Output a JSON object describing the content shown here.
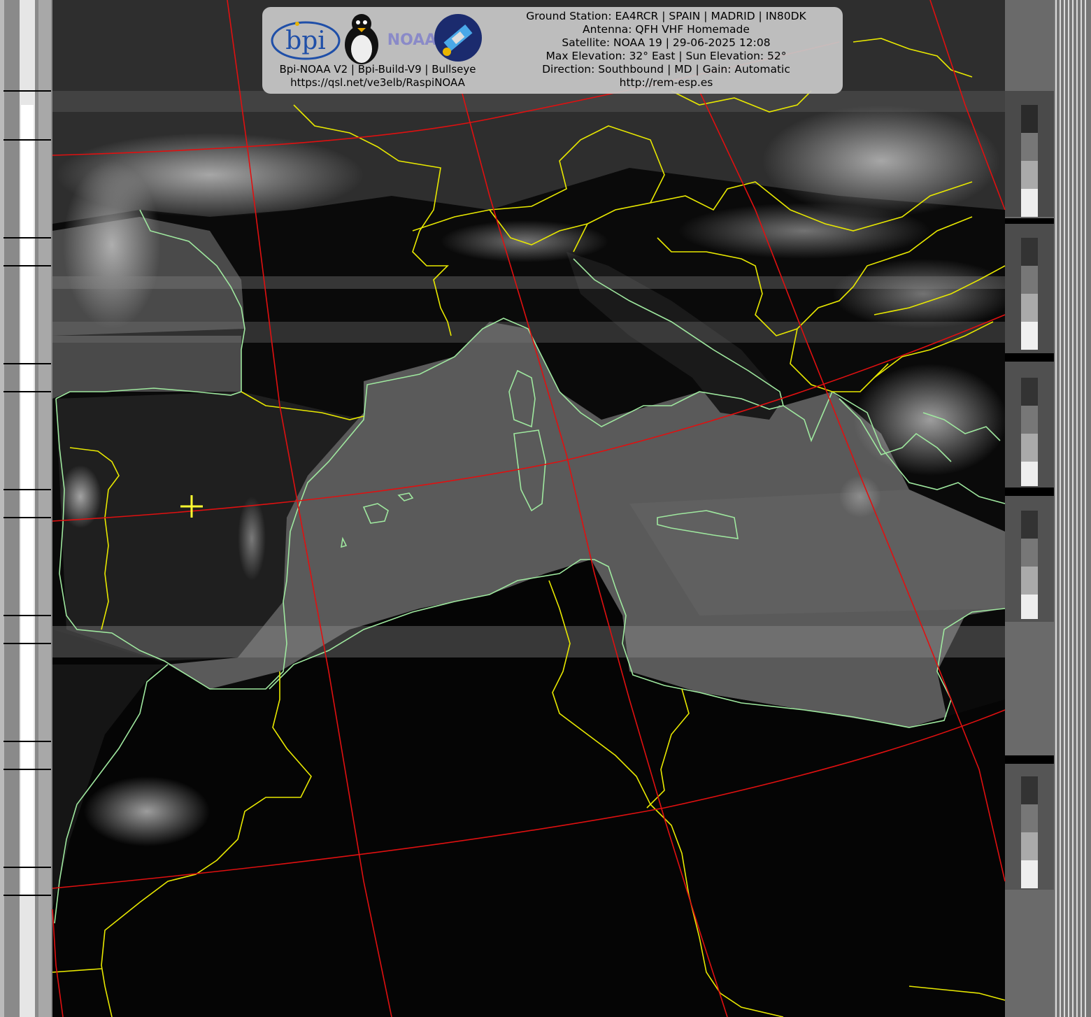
{
  "panel": {
    "software_line": "Bpi-NOAA V2 | Bpi-Build-V9 | Bullseye",
    "url_line": "https://qsl.net/ve3elb/RaspiNOAA",
    "logos": {
      "bpi": "bpi",
      "tux": "tux-penguin-icon",
      "noaa": "NOAA",
      "satellite": "satellite-icon"
    }
  },
  "station": {
    "ground_station": "Ground Station: EA4RCR | SPAIN | MADRID | IN80DK",
    "antenna": "Antenna: QFH VHF Homemade",
    "satellite": "Satellite: NOAA 19 | 29-06-2025 12:08",
    "elevation": "Max Elevation: 32° East | Sun Elevation: 52°",
    "direction": "Direction: Southbound | MD | Gain: Automatic",
    "website": "http://rem-esp.es"
  },
  "colors": {
    "graticule": "#e01010",
    "borders": "#e8e800",
    "coastline": "#9fe89f",
    "marker": "#ffff30",
    "panel_bg": "#c8c8c8"
  }
}
